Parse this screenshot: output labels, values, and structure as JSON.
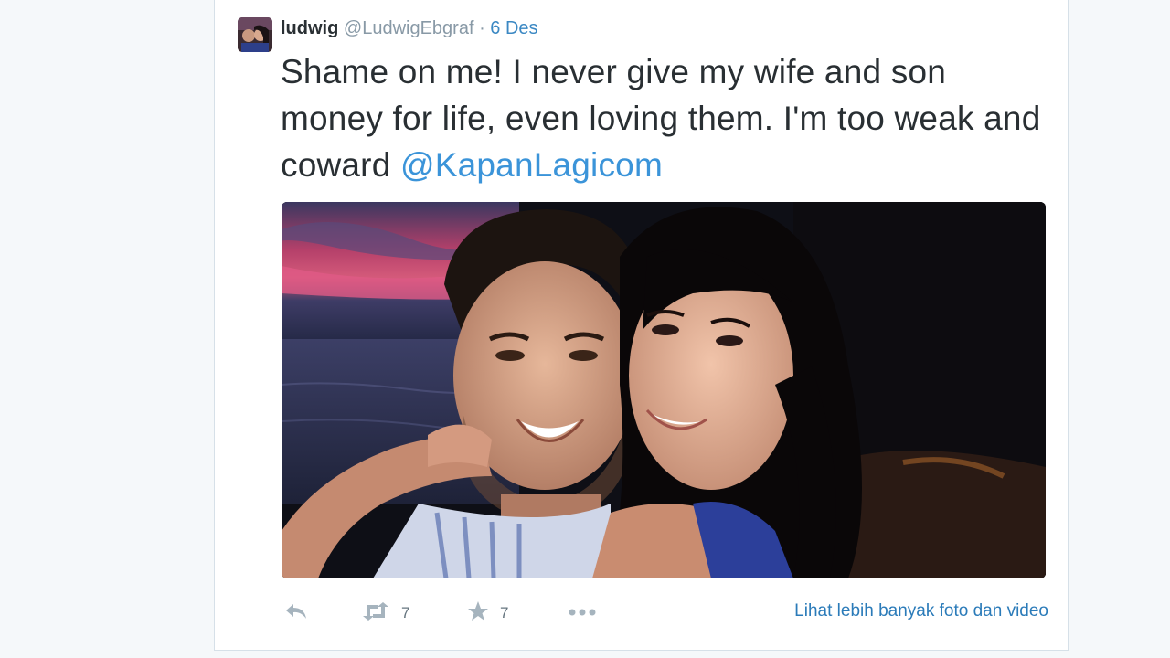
{
  "tweet": {
    "author_name": "ludwig",
    "author_handle": "@LudwigEbgraf",
    "separator": "·",
    "timestamp": "6 Des",
    "text": "Shame on me! I never give my wife and son money for life, even loving them. I'm too weak and coward ",
    "mention": "@KapanLagicom",
    "media_icon": "photo-couple-selfie",
    "actions": {
      "reply_icon": "reply-icon",
      "retweet_icon": "retweet-icon",
      "retweet_count": "7",
      "favorite_icon": "star-icon",
      "favorite_count": "7",
      "more_icon": "more-dots-icon"
    },
    "more_link": "Lihat lebih banyak foto dan video"
  },
  "colors": {
    "page_bg": "#f5f8fa",
    "text": "#292f33",
    "muted": "#8899a6",
    "link": "#3b94d9"
  }
}
